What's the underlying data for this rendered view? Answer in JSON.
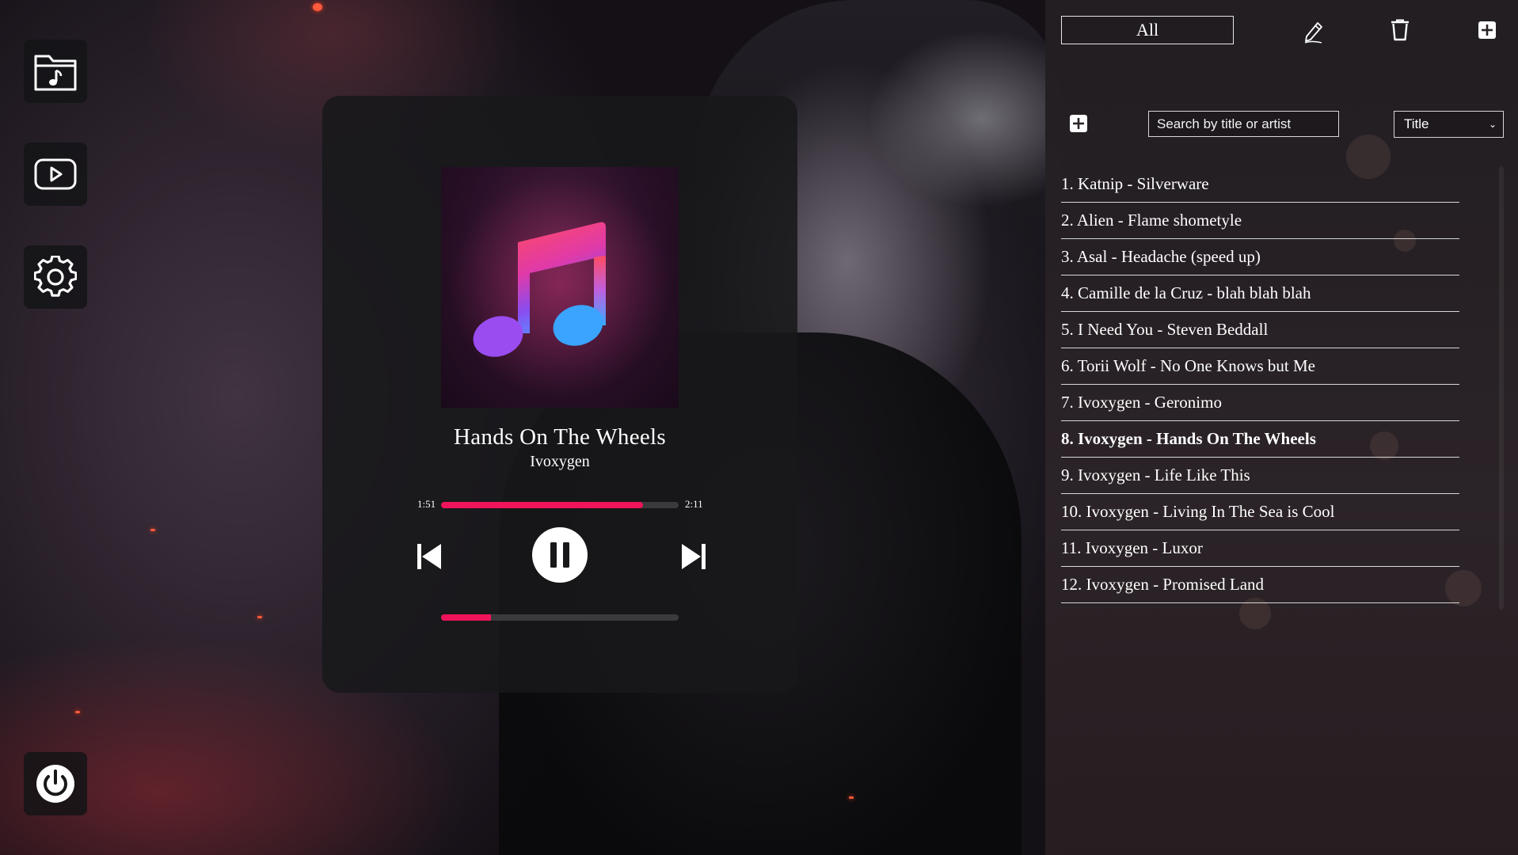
{
  "sidebar": {
    "items": [
      {
        "icon": "music-folder-icon"
      },
      {
        "icon": "video-play-icon"
      },
      {
        "icon": "gear-icon"
      }
    ],
    "power_icon": "power-icon"
  },
  "player": {
    "title": "Hands On The Wheels",
    "artist": "Ivoxygen",
    "elapsed": "1:51",
    "duration": "2:11",
    "progress_fraction": 0.85,
    "volume_fraction": 0.21,
    "state": "playing"
  },
  "panel": {
    "playlist_filter": "All",
    "search_placeholder": "Search by title or artist",
    "sort_value": "Title",
    "tracks": [
      {
        "label": "1. Katnip - Silverware",
        "active": false
      },
      {
        "label": "2. Alien - Flame shometyle",
        "active": false
      },
      {
        "label": "3. Asal - Headache (speed up)",
        "active": false
      },
      {
        "label": "4. Camille de la Cruz - blah blah blah",
        "active": false
      },
      {
        "label": "5. I Need You - Steven Beddall",
        "active": false
      },
      {
        "label": "6. Torii Wolf - No One Knows but Me",
        "active": false
      },
      {
        "label": "7. Ivoxygen - Geronimo",
        "active": false
      },
      {
        "label": "8. Ivoxygen - Hands On The Wheels",
        "active": true
      },
      {
        "label": "9. Ivoxygen - Life Like This",
        "active": false
      },
      {
        "label": "10. Ivoxygen - Living In The Sea is Cool",
        "active": false
      },
      {
        "label": "11. Ivoxygen - Luxor",
        "active": false
      },
      {
        "label": "12. Ivoxygen - Promised Land",
        "active": false
      }
    ]
  },
  "colors": {
    "accent": "#f0145a",
    "track_bg": "#3a3a3c",
    "card_bg": "#18181a"
  }
}
